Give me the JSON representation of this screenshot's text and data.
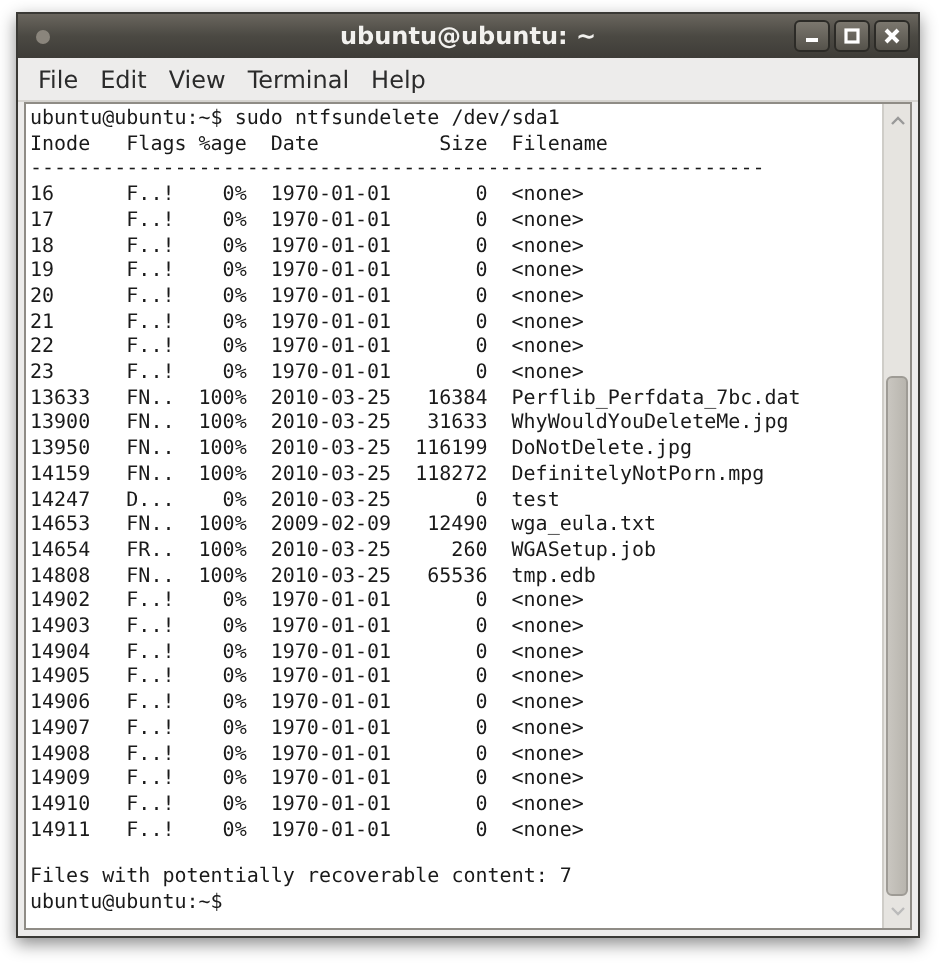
{
  "window": {
    "title": "ubuntu@ubuntu: ~"
  },
  "menu": [
    "File",
    "Edit",
    "View",
    "Terminal",
    "Help"
  ],
  "terminal": {
    "command_line": "ubuntu@ubuntu:~$ sudo ntfsundelete /dev/sda1",
    "columns": [
      "Inode",
      "Flags",
      "%age",
      "Date",
      "Size",
      "Filename"
    ],
    "separator": "-------------------------------------------------------------",
    "rows": [
      [
        "16",
        "F..!",
        "0%",
        "1970-01-01",
        "0",
        "<none>"
      ],
      [
        "17",
        "F..!",
        "0%",
        "1970-01-01",
        "0",
        "<none>"
      ],
      [
        "18",
        "F..!",
        "0%",
        "1970-01-01",
        "0",
        "<none>"
      ],
      [
        "19",
        "F..!",
        "0%",
        "1970-01-01",
        "0",
        "<none>"
      ],
      [
        "20",
        "F..!",
        "0%",
        "1970-01-01",
        "0",
        "<none>"
      ],
      [
        "21",
        "F..!",
        "0%",
        "1970-01-01",
        "0",
        "<none>"
      ],
      [
        "22",
        "F..!",
        "0%",
        "1970-01-01",
        "0",
        "<none>"
      ],
      [
        "23",
        "F..!",
        "0%",
        "1970-01-01",
        "0",
        "<none>"
      ],
      [
        "13633",
        "FN..",
        "100%",
        "2010-03-25",
        "16384",
        "Perflib_Perfdata_7bc.dat"
      ],
      [
        "13900",
        "FN..",
        "100%",
        "2010-03-25",
        "31633",
        "WhyWouldYouDeleteMe.jpg"
      ],
      [
        "13950",
        "FN..",
        "100%",
        "2010-03-25",
        "116199",
        "DoNotDelete.jpg"
      ],
      [
        "14159",
        "FN..",
        "100%",
        "2010-03-25",
        "118272",
        "DefinitelyNotPorn.mpg"
      ],
      [
        "14247",
        "D...",
        "0%",
        "2010-03-25",
        "0",
        "test"
      ],
      [
        "14653",
        "FN..",
        "100%",
        "2009-02-09",
        "12490",
        "wga_eula.txt"
      ],
      [
        "14654",
        "FR..",
        "100%",
        "2010-03-25",
        "260",
        "WGASetup.job"
      ],
      [
        "14808",
        "FN..",
        "100%",
        "2010-03-25",
        "65536",
        "tmp.edb"
      ],
      [
        "14902",
        "F..!",
        "0%",
        "1970-01-01",
        "0",
        "<none>"
      ],
      [
        "14903",
        "F..!",
        "0%",
        "1970-01-01",
        "0",
        "<none>"
      ],
      [
        "14904",
        "F..!",
        "0%",
        "1970-01-01",
        "0",
        "<none>"
      ],
      [
        "14905",
        "F..!",
        "0%",
        "1970-01-01",
        "0",
        "<none>"
      ],
      [
        "14906",
        "F..!",
        "0%",
        "1970-01-01",
        "0",
        "<none>"
      ],
      [
        "14907",
        "F..!",
        "0%",
        "1970-01-01",
        "0",
        "<none>"
      ],
      [
        "14908",
        "F..!",
        "0%",
        "1970-01-01",
        "0",
        "<none>"
      ],
      [
        "14909",
        "F..!",
        "0%",
        "1970-01-01",
        "0",
        "<none>"
      ],
      [
        "14910",
        "F..!",
        "0%",
        "1970-01-01",
        "0",
        "<none>"
      ],
      [
        "14911",
        "F..!",
        "0%",
        "1970-01-01",
        "0",
        "<none>"
      ]
    ],
    "summary": "Files with potentially recoverable content: 7",
    "prompt": "ubuntu@ubuntu:~$"
  }
}
